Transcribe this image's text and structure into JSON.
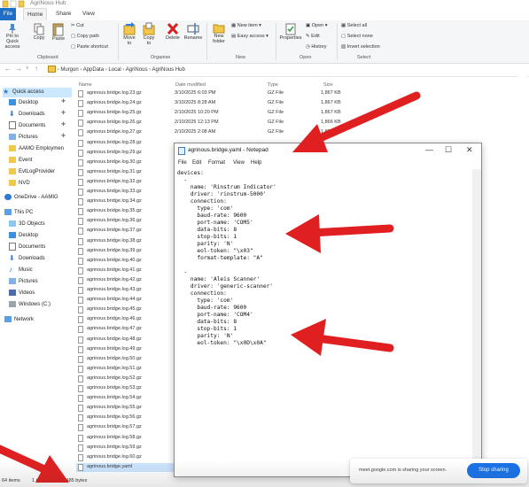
{
  "window": {
    "title": "AgriNous Hub"
  },
  "ribbon_tabs": [
    "File",
    "Home",
    "Share",
    "View"
  ],
  "ribbon": {
    "pin_label": "Pin to Quick access",
    "copy_label": "Copy",
    "paste_label": "Paste",
    "cut_label": "Cut",
    "copy_path_label": "Copy path",
    "paste_shortcut_label": "Paste shortcut",
    "move_to_label": "Move to",
    "copy_to_label": "Copy to",
    "delete_label": "Delete",
    "rename_label": "Rename",
    "new_folder_label": "New folder",
    "new_item_label": "New item",
    "easy_access_label": "Easy access",
    "properties_label": "Properties",
    "open_label": "Open",
    "edit_label": "Edit",
    "history_label": "History",
    "select_all_label": "Select all",
    "select_none_label": "Select none",
    "invert_selection_label": "Invert selection",
    "groups": [
      "Clipboard",
      "Organise",
      "New",
      "Open",
      "Select"
    ]
  },
  "address": {
    "crumbs": [
      "Murgon",
      "AppData",
      "Local",
      "AgriNous",
      "AgriNous Hub"
    ]
  },
  "nav": {
    "items": [
      {
        "label": "Quick access"
      },
      {
        "label": "Desktop"
      },
      {
        "label": "Downloads"
      },
      {
        "label": "Documents"
      },
      {
        "label": "Pictures"
      },
      {
        "label": "AAMO Employmen"
      },
      {
        "label": "Event"
      },
      {
        "label": "EvtLogProvider"
      },
      {
        "label": "NVD"
      },
      {
        "label": "OneDrive - AAMIG"
      },
      {
        "label": "This PC"
      },
      {
        "label": "3D Objects"
      },
      {
        "label": "Desktop"
      },
      {
        "label": "Documents"
      },
      {
        "label": "Downloads"
      },
      {
        "label": "Music"
      },
      {
        "label": "Pictures"
      },
      {
        "label": "Videos"
      },
      {
        "label": "Windows (C:)"
      },
      {
        "label": "Network"
      }
    ]
  },
  "columns": {
    "name": "Name",
    "date": "Date modified",
    "type": "Type",
    "size": "Size"
  },
  "files": [
    {
      "name": "agrinous.bridge.log.23.gz",
      "date": "3/10/2025 6:03 PM",
      "type": "GZ File",
      "size": "1,867 KB"
    },
    {
      "name": "agrinous.bridge.log.24.gz",
      "date": "3/10/2025 8:28 AM",
      "type": "GZ File",
      "size": "1,867 KB"
    },
    {
      "name": "agrinous.bridge.log.25.gz",
      "date": "2/10/2025 10:20 PM",
      "type": "GZ File",
      "size": "1,867 KB"
    },
    {
      "name": "agrinous.bridge.log.26.gz",
      "date": "2/10/2025 12:13 PM",
      "type": "GZ File",
      "size": "1,866 KB"
    },
    {
      "name": "agrinous.bridge.log.27.gz",
      "date": "2/10/2025 2:08 AM",
      "type": "GZ File",
      "size": "1,866 KB"
    },
    {
      "name": "agrinous.bridge.log.28.gz",
      "date": "",
      "type": "",
      "size": ""
    },
    {
      "name": "agrinous.bridge.log.29.gz",
      "date": "",
      "type": "",
      "size": ""
    },
    {
      "name": "agrinous.bridge.log.30.gz",
      "date": "",
      "type": "",
      "size": ""
    },
    {
      "name": "agrinous.bridge.log.31.gz",
      "date": "",
      "type": "",
      "size": ""
    },
    {
      "name": "agrinous.bridge.log.32.gz",
      "date": "",
      "type": "",
      "size": ""
    },
    {
      "name": "agrinous.bridge.log.33.gz",
      "date": "",
      "type": "",
      "size": ""
    },
    {
      "name": "agrinous.bridge.log.34.gz",
      "date": "",
      "type": "",
      "size": ""
    },
    {
      "name": "agrinous.bridge.log.35.gz",
      "date": "",
      "type": "",
      "size": ""
    },
    {
      "name": "agrinous.bridge.log.36.gz",
      "date": "",
      "type": "",
      "size": ""
    },
    {
      "name": "agrinous.bridge.log.37.gz",
      "date": "",
      "type": "",
      "size": ""
    },
    {
      "name": "agrinous.bridge.log.38.gz",
      "date": "",
      "type": "",
      "size": ""
    },
    {
      "name": "agrinous.bridge.log.39.gz",
      "date": "",
      "type": "",
      "size": ""
    },
    {
      "name": "agrinous.bridge.log.40.gz",
      "date": "",
      "type": "",
      "size": ""
    },
    {
      "name": "agrinous.bridge.log.41.gz",
      "date": "",
      "type": "",
      "size": ""
    },
    {
      "name": "agrinous.bridge.log.42.gz",
      "date": "",
      "type": "",
      "size": ""
    },
    {
      "name": "agrinous.bridge.log.43.gz",
      "date": "",
      "type": "",
      "size": ""
    },
    {
      "name": "agrinous.bridge.log.44.gz",
      "date": "",
      "type": "",
      "size": ""
    },
    {
      "name": "agrinous.bridge.log.45.gz",
      "date": "",
      "type": "",
      "size": ""
    },
    {
      "name": "agrinous.bridge.log.46.gz",
      "date": "",
      "type": "",
      "size": ""
    },
    {
      "name": "agrinous.bridge.log.47.gz",
      "date": "",
      "type": "",
      "size": ""
    },
    {
      "name": "agrinous.bridge.log.48.gz",
      "date": "",
      "type": "",
      "size": ""
    },
    {
      "name": "agrinous.bridge.log.49.gz",
      "date": "",
      "type": "",
      "size": ""
    },
    {
      "name": "agrinous.bridge.log.50.gz",
      "date": "",
      "type": "",
      "size": ""
    },
    {
      "name": "agrinous.bridge.log.51.gz",
      "date": "",
      "type": "",
      "size": ""
    },
    {
      "name": "agrinous.bridge.log.52.gz",
      "date": "",
      "type": "",
      "size": ""
    },
    {
      "name": "agrinous.bridge.log.53.gz",
      "date": "",
      "type": "",
      "size": ""
    },
    {
      "name": "agrinous.bridge.log.54.gz",
      "date": "",
      "type": "",
      "size": ""
    },
    {
      "name": "agrinous.bridge.log.55.gz",
      "date": "",
      "type": "",
      "size": ""
    },
    {
      "name": "agrinous.bridge.log.56.gz",
      "date": "",
      "type": "",
      "size": ""
    },
    {
      "name": "agrinous.bridge.log.57.gz",
      "date": "",
      "type": "",
      "size": ""
    },
    {
      "name": "agrinous.bridge.log.58.gz",
      "date": "",
      "type": "",
      "size": ""
    },
    {
      "name": "agrinous.bridge.log.59.gz",
      "date": "",
      "type": "",
      "size": ""
    },
    {
      "name": "agrinous.bridge.log.60.gz",
      "date": "",
      "type": "",
      "size": ""
    },
    {
      "name": "agrinous.bridge.yaml",
      "date": "",
      "type": "",
      "size": ""
    }
  ],
  "status": {
    "count": "64 items",
    "selected": "1 item selected 485 bytes"
  },
  "notepad": {
    "title": "agrinous.bridge.yaml - Notepad",
    "menu": [
      "File",
      "Edit",
      "Format",
      "View",
      "Help"
    ],
    "text": "devices:\n  -\n    name: 'Rinstrum Indicator'\n    driver: 'rinstrum-5000'\n    connection:\n      type: 'com'\n      baud-rate: 9600\n      port-name: 'COM5'\n      data-bits: 8\n      stop-bits: 1\n      parity: 'N'\n      eol-token: \"\\x03\"\n      format-template: \"A\"\n\n  -\n    name: 'Aleis Scanner'\n    driver: 'generic-scanner'\n    connection:\n      type: 'com'\n      baud-rate: 9600\n      port-name: 'COM4'\n      data-bits: 8\n      stop-bits: 1\n      parity: 'N'\n      eol-token: \"\\x0D\\x0A\""
  },
  "meet": {
    "message": "meet.google.com is sharing your screen.",
    "stop_label": "Stop sharing"
  },
  "colors": {
    "accent": "#1f6fc6",
    "arrow": "#e02020",
    "meet_button": "#1a73e8",
    "selection": "#cce5ff"
  }
}
